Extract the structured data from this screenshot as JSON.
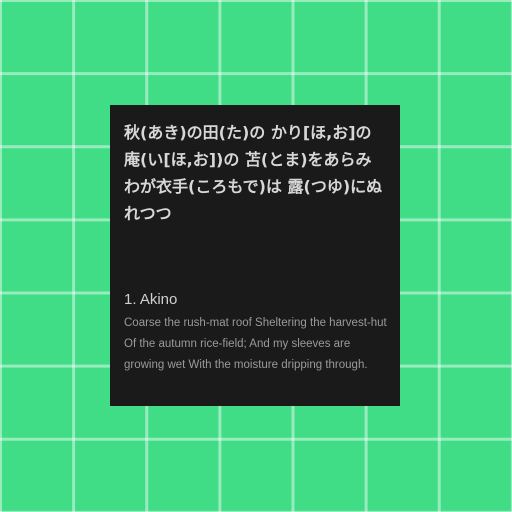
{
  "card": {
    "poem": "秋(あき)の田(た)の かり[ほ,お]の庵(い[ほ,お])の 苫(とま)をあらみ わが衣手(ころもで)は 露(つゆ)にぬれつつ",
    "title": "1. Akino",
    "translation": "Coarse the rush-mat roof Sheltering the harvest-hut Of the autumn rice-field; And my sleeves are growing wet With the moisture dripping through."
  },
  "colors": {
    "background": "#41dd86",
    "grid_lines": "#ffffff",
    "card_background": "#1a1a1a",
    "poem_text": "#d7d7d7",
    "title_text": "#cfcfcf",
    "translation_text": "#9a9a9a"
  }
}
